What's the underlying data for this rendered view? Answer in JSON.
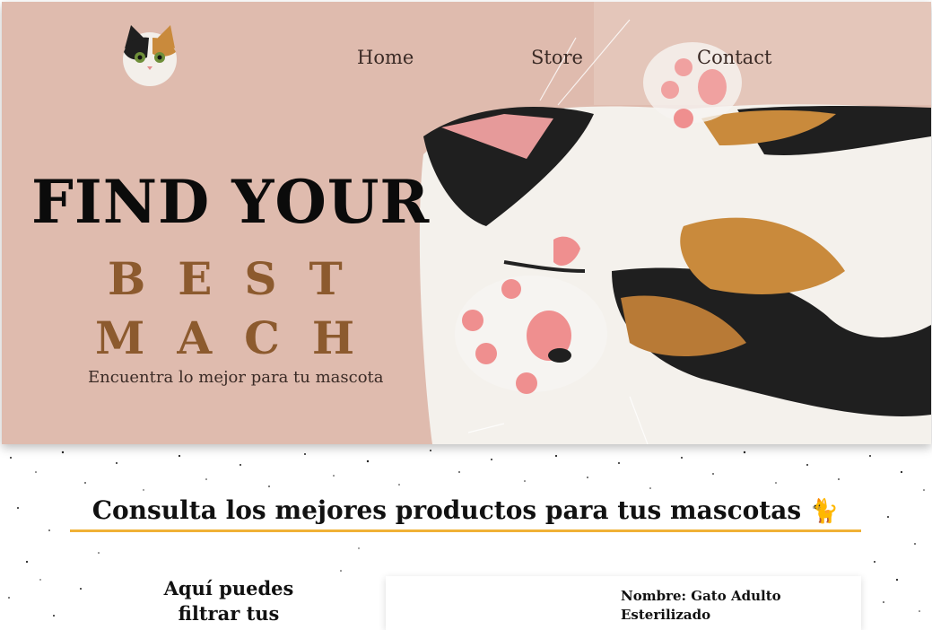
{
  "nav": {
    "home": "Home",
    "store": "Store",
    "contact": "Contact"
  },
  "hero": {
    "title_line1": "FIND YOUR",
    "title_line2": "BEST",
    "title_line3": "MACH",
    "subtitle": "Encuentra lo mejor para tu mascota"
  },
  "section": {
    "title": "Consulta los mejores productos para tus mascotas",
    "emoji": "🐈"
  },
  "filter": {
    "text": "Aquí puedes filtrar tus"
  },
  "product": {
    "name": "Nombre: Gato Adulto Esterilizado"
  },
  "colors": {
    "hero_bg": "#dfbbae",
    "accent_brown": "#8c5a2e",
    "underline_gold": "#f0b136"
  }
}
